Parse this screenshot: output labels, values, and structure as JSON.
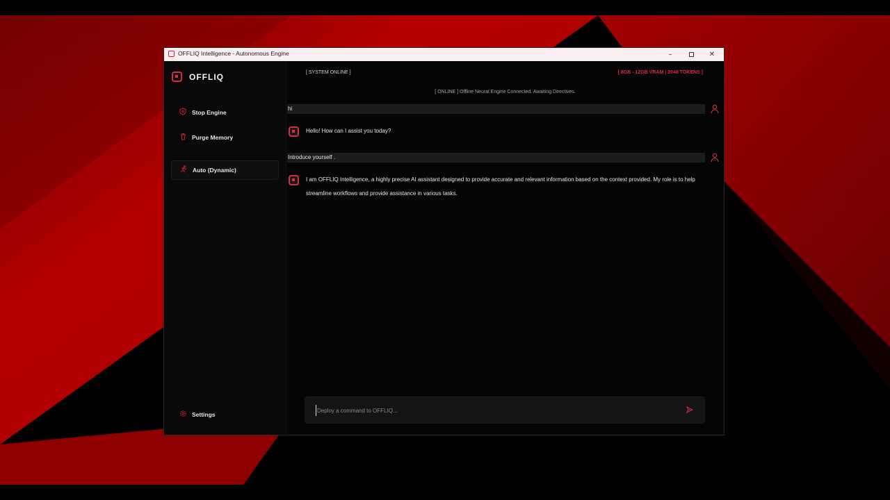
{
  "window": {
    "title": "OFFLIQ Intelligence - Autonomous Engine",
    "minimize_icon": "minimize-icon",
    "maximize_icon": "maximize-icon",
    "close_icon": "close-icon"
  },
  "sidebar": {
    "logo_text": "OFFLIQ",
    "items": [
      {
        "label": "Stop Engine",
        "icon": "stop-shield-icon"
      },
      {
        "label": "Purge Memory",
        "icon": "trash-icon"
      },
      {
        "label": "Auto (Dynamic)",
        "icon": "running-person-icon",
        "active": true
      }
    ],
    "settings_label": "Settings",
    "settings_icon": "gear-icon"
  },
  "header": {
    "status_left": "[ SYSTEM ONLINE ]",
    "status_right": "[ 8GB - 12GB VRAM | 2048 TOKENS ]"
  },
  "chat": {
    "system_message": "[ ONLINE ] Offline Neural Engine Connected. Awaiting Directives.",
    "messages": [
      {
        "role": "user",
        "text": "hi"
      },
      {
        "role": "assistant",
        "text": "Hello! How can I assist you today?"
      },
      {
        "role": "user",
        "text": "Introduce yourself ."
      },
      {
        "role": "assistant",
        "text": "I am OFFLIQ Intelligence, a highly precise AI assistant designed to provide accurate and relevant information based on the context provided. My role is to help streamline workflows and provide assistance in various tasks."
      }
    ]
  },
  "composer": {
    "placeholder": "Deploy a command to OFFLIQ...",
    "value": "",
    "send_icon": "send-icon"
  },
  "colors": {
    "accent": "#e02b43",
    "window_bg": "#050505",
    "sidebar_bg": "#090909",
    "user_bubble": "#1c1c1c",
    "titlebar": "#fbeef0",
    "wallpaper_red": "#b00000"
  }
}
